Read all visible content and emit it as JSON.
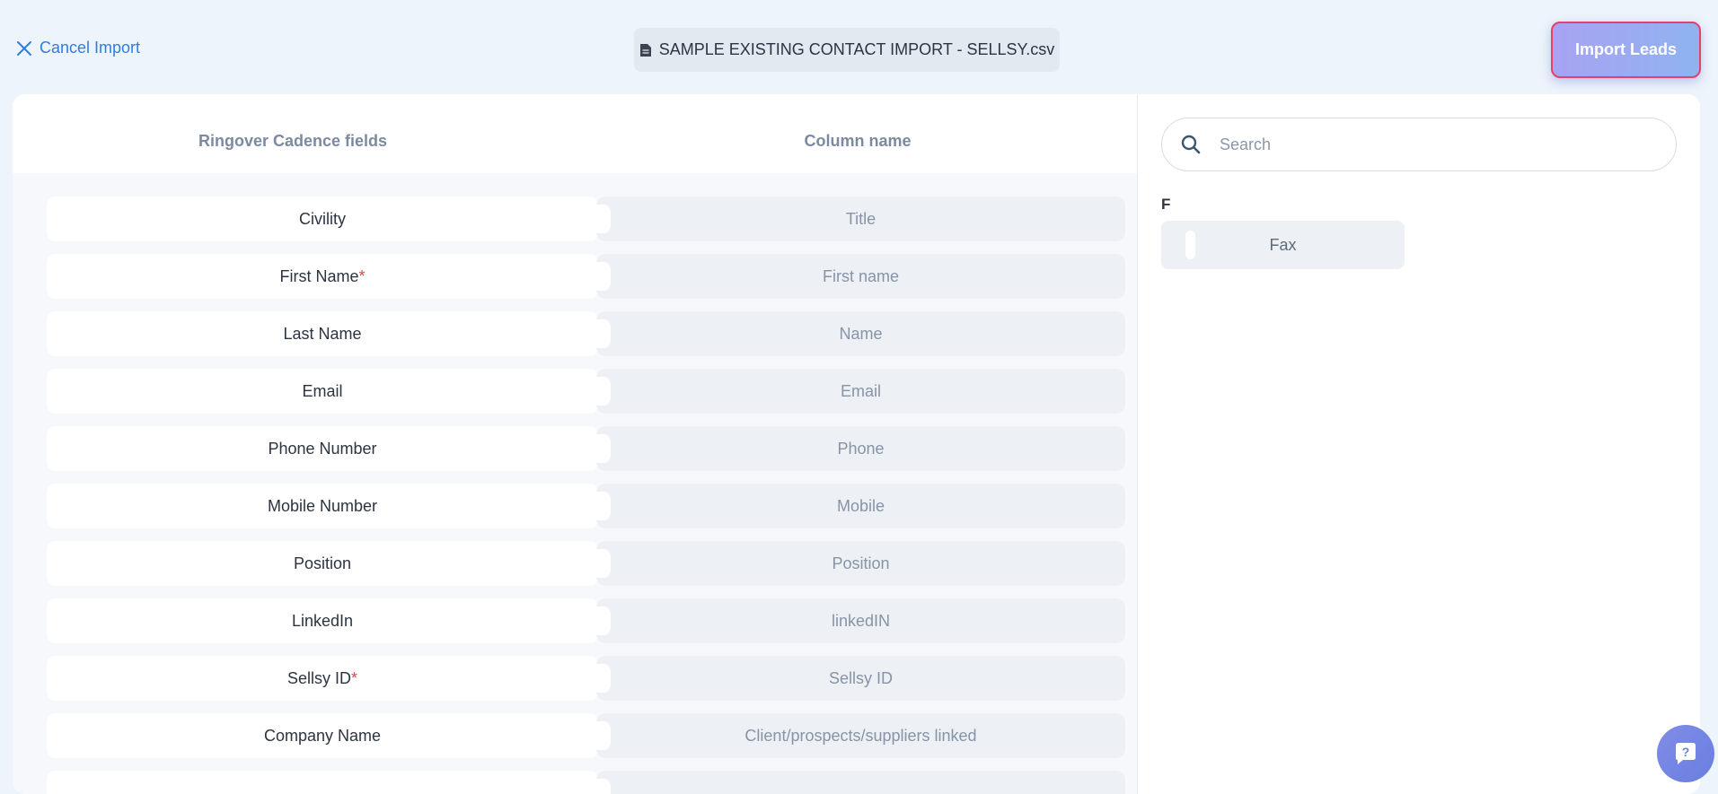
{
  "header": {
    "cancel_label": "Cancel Import",
    "file_name": "SAMPLE EXISTING CONTACT IMPORT - SELLSY.csv",
    "import_label": "Import Leads"
  },
  "mapping": {
    "col_fields": "Ringover Cadence fields",
    "col_columns": "Column name",
    "rows": [
      {
        "field": "Civility",
        "required": false,
        "column": "Title"
      },
      {
        "field": "First Name",
        "required": true,
        "column": "First name"
      },
      {
        "field": "Last Name",
        "required": false,
        "column": "Name"
      },
      {
        "field": "Email",
        "required": false,
        "column": "Email"
      },
      {
        "field": "Phone Number",
        "required": false,
        "column": "Phone"
      },
      {
        "field": "Mobile Number",
        "required": false,
        "column": "Mobile"
      },
      {
        "field": "Position",
        "required": false,
        "column": "Position"
      },
      {
        "field": "LinkedIn",
        "required": false,
        "column": "linkedIN"
      },
      {
        "field": "Sellsy ID",
        "required": true,
        "column": "Sellsy ID"
      },
      {
        "field": "Company Name",
        "required": false,
        "column": "Client/prospects/suppliers linked"
      },
      {
        "field": "",
        "required": false,
        "column": ""
      }
    ],
    "required_marker": "*"
  },
  "panel": {
    "search_placeholder": "Search",
    "group_letter": "F",
    "available_columns": [
      "Fax"
    ]
  },
  "colors": {
    "accent": "#2e7de1",
    "required": "#e14646",
    "import_border": "#e0426c"
  }
}
